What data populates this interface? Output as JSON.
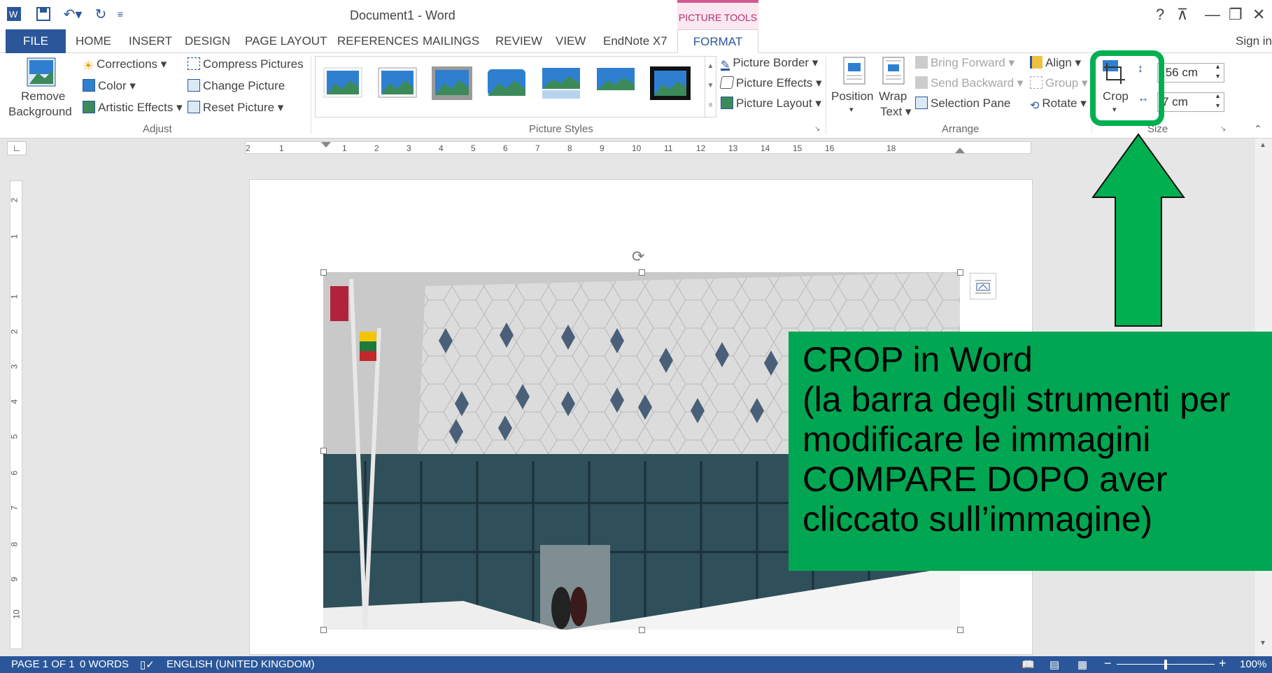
{
  "window": {
    "title": "Document1 - Word",
    "context_tab_group": "PICTURE TOOLS",
    "help": "?",
    "restore_ribbon": "⊼",
    "minimize": "—",
    "maximize": "❐",
    "close": "✕"
  },
  "tabs": [
    "FILE",
    "HOME",
    "INSERT",
    "DESIGN",
    "PAGE LAYOUT",
    "REFERENCES",
    "MAILINGS",
    "REVIEW",
    "VIEW",
    "EndNote X7",
    "FORMAT"
  ],
  "sign_in": "Sign in",
  "ribbon": {
    "adjust": {
      "remove_background_line1": "Remove",
      "remove_background_line2": "Background",
      "corrections": "Corrections",
      "color": "Color",
      "artistic_effects": "Artistic Effects",
      "compress_pictures": "Compress Pictures",
      "change_picture": "Change Picture",
      "reset_picture": "Reset Picture",
      "group_label": "Adjust"
    },
    "picture_styles": {
      "picture_border": "Picture Border",
      "picture_effects": "Picture Effects",
      "picture_layout": "Picture Layout",
      "group_label": "Picture Styles"
    },
    "arrange": {
      "position": "Position",
      "wrap_text_line1": "Wrap",
      "wrap_text_line2": "Text",
      "bring_forward": "Bring Forward",
      "send_backward": "Send Backward",
      "selection_pane": "Selection Pane",
      "align": "Align",
      "group": "Group",
      "rotate": "Rotate",
      "group_label": "Arrange"
    },
    "size": {
      "crop": "Crop",
      "height": ",56 cm",
      "width": "7 cm",
      "group_label": "Size"
    }
  },
  "ruler": {
    "corner": "∟",
    "h_numbers": [
      "2",
      "1",
      "1",
      "2",
      "3",
      "4",
      "5",
      "6",
      "7",
      "8",
      "9",
      "10",
      "11",
      "12",
      "13",
      "14",
      "15",
      "16",
      "18"
    ],
    "v_numbers": [
      "2",
      "1",
      "1",
      "2",
      "3",
      "4",
      "5",
      "6",
      "7",
      "8",
      "9",
      "10"
    ]
  },
  "status": {
    "page": "PAGE 1 OF 1",
    "words": "0 WORDS",
    "language": "ENGLISH (UNITED KINGDOM)",
    "zoom_minus": "−",
    "zoom_plus": "+",
    "zoom": "100%"
  },
  "callout": {
    "text": "CROP in Word\n(la barra degli strumenti per modificare le immagini COMPARE DOPO aver cliccato sull’immagine)"
  },
  "colors": {
    "accent": "#2b579a",
    "callout_green": "#00a651",
    "highlight_green": "#00b050"
  }
}
